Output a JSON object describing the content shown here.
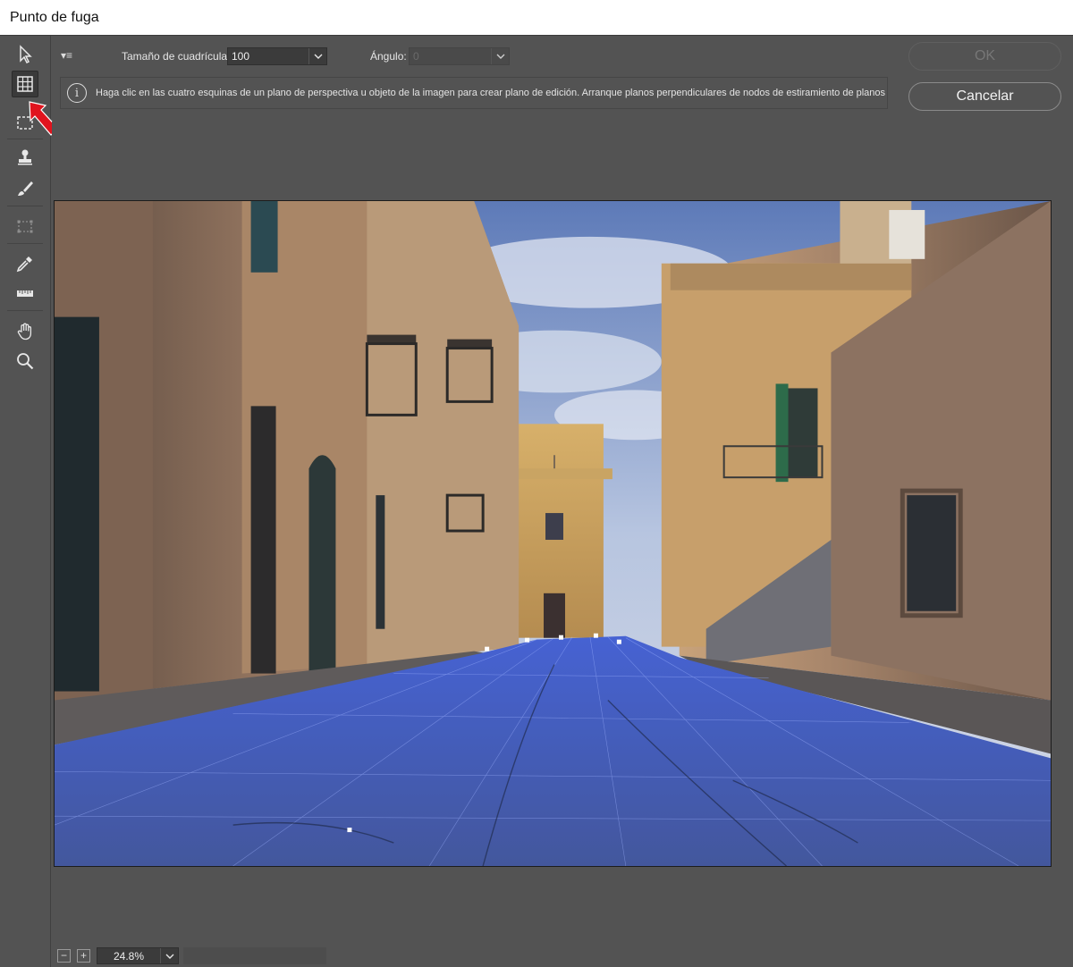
{
  "window": {
    "title": "Punto de fuga"
  },
  "options": {
    "menu_icon": "▾≡",
    "grid_size_label": "Tamaño de cuadrícula:",
    "grid_size_value": "100",
    "angle_label": "Ángulo:",
    "angle_value": "0"
  },
  "info": {
    "icon": "i",
    "message": "Haga clic en las cuatro esquinas de un plano de perspectiva u objeto de la imagen para crear plano de edición. Arranque planos perpendiculares de nodos de estiramiento de planos"
  },
  "buttons": {
    "ok_label": "OK",
    "cancel_label": "Cancelar"
  },
  "tools": [
    {
      "name": "edit-plane-tool",
      "icon": "arrow-pointer-icon",
      "active": false
    },
    {
      "name": "create-plane-tool",
      "icon": "grid-plane-icon",
      "active": true
    },
    {
      "name": "marquee-tool",
      "icon": "marquee-icon",
      "active": false
    },
    {
      "name": "stamp-tool",
      "icon": "stamp-icon",
      "active": false
    },
    {
      "name": "brush-tool",
      "icon": "brush-icon",
      "active": false
    },
    {
      "name": "transform-tool",
      "icon": "transform-icon",
      "active": false
    },
    {
      "name": "eyedropper-tool",
      "icon": "eyedropper-icon",
      "active": false
    },
    {
      "name": "measure-tool",
      "icon": "ruler-icon",
      "active": false
    },
    {
      "name": "hand-tool",
      "icon": "hand-icon",
      "active": false
    },
    {
      "name": "zoom-tool",
      "icon": "magnifier-icon",
      "active": false
    }
  ],
  "zoom": {
    "minus": "−",
    "plus": "+",
    "value": "24.8%"
  },
  "colors": {
    "panel": "#535353",
    "plane_overlay": "#3f64ff",
    "annotation_arrow": "#e0141e"
  }
}
